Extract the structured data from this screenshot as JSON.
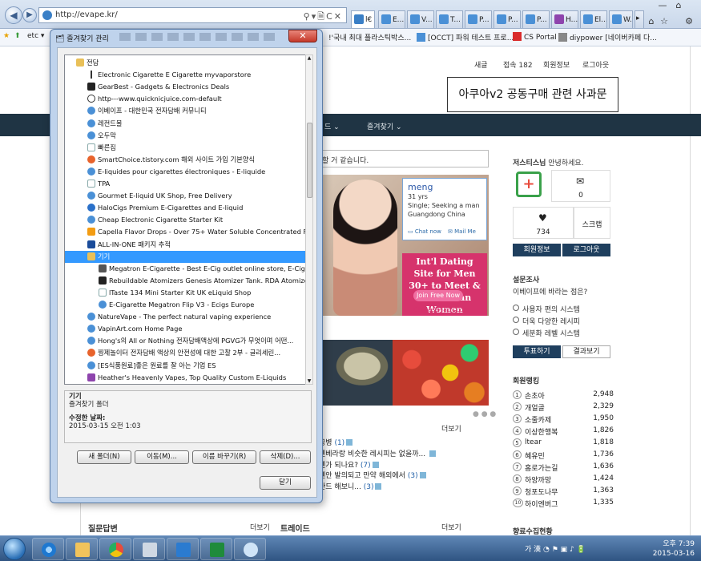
{
  "browser": {
    "url": "http://evape.kr/",
    "tabs": [
      "l€",
      "E...",
      "V...",
      "T...",
      "P...",
      "P...",
      "P...",
      "H...",
      "El...",
      "W..."
    ],
    "favorites_bar": [
      "etc",
      "!'국내 최대 플라스틱박스...",
      "[OCCT] 파워 테스트 프로...",
      "CS Portal",
      "diypower [네이버카페 다..."
    ]
  },
  "site": {
    "top_links": [
      "새글",
      "접속 182",
      "회원정보",
      "로그아웃"
    ],
    "notice": "아쿠아v2 공동구매 관련 사과문",
    "nav": [
      "드",
      "즐겨찾기"
    ],
    "marquee": "할 거 같습니다.",
    "ad": {
      "name": "meng",
      "age": "31 yrs",
      "seek": "Single; Seeking a man",
      "loc": "Guangdong China",
      "chat": "Chat now",
      "mail": "Mail Me",
      "headline": "Int'l Dating Site for Men 30+ to Meet & Date Asian Women",
      "join": "Join Free Now",
      "domain": "Chinese-lady.com"
    },
    "more1": "더보기",
    "posts": [
      {
        "text": "공병",
        "count": "(1)"
      },
      {
        "text": "덴베라랑 비슷한 레시피는 없을까...",
        "count": ""
      },
      {
        "text": "렌가 되나요?",
        "count": "(7)"
      },
      {
        "text": "텐안 발의되고 만약 해외에서",
        "count": "(3)"
      },
      {
        "text": "탄드 해보니...",
        "count": "(3)"
      }
    ],
    "bottom": {
      "qa": "질문답변",
      "trade": "트레이드",
      "more": "더보기",
      "more2": "더보기"
    },
    "sidebar": {
      "user": "저스티스님",
      "greet": "안녕하세요.",
      "mail_count": "0",
      "heart_count": "734",
      "scrap": "스크랩",
      "btn_info": "회원정보",
      "btn_logout": "로그아웃",
      "survey_title": "설문조사",
      "survey_q": "이베이프에 바라는 점은?",
      "survey_opts": [
        "사용자 편의 시스템",
        "더욱 다양한 레시피",
        "세분화 레벨 시스템"
      ],
      "vote": "투표하기",
      "result": "결과보기",
      "rank_title": "회원랭킹",
      "ranks": [
        {
          "n": "1",
          "name": "손초아",
          "pts": "2,948"
        },
        {
          "n": "2",
          "name": "개얼골",
          "pts": "2,329"
        },
        {
          "n": "3",
          "name": "소줄카제",
          "pts": "1,950"
        },
        {
          "n": "4",
          "name": "이상한행복",
          "pts": "1,826"
        },
        {
          "n": "5",
          "name": "ltear",
          "pts": "1,818"
        },
        {
          "n": "6",
          "name": "혜유민",
          "pts": "1,736"
        },
        {
          "n": "7",
          "name": "홈로가는길",
          "pts": "1,636"
        },
        {
          "n": "8",
          "name": "하양까망",
          "pts": "1,424"
        },
        {
          "n": "9",
          "name": "청포도나무",
          "pts": "1,363"
        },
        {
          "n": "10",
          "name": "하이엔버그",
          "pts": "1,335"
        }
      ],
      "stats_title": "향료수집현황"
    }
  },
  "dialog": {
    "title": "즐겨찾기 관리",
    "items": [
      {
        "label": "전담",
        "indent": 0,
        "type": "folder"
      },
      {
        "label": "Electronic Cigarette  E Cigarette  myvaporstore",
        "indent": 1,
        "type": "pen"
      },
      {
        "label": "GearBest - Gadgets & Electronics Deals",
        "indent": 1,
        "type": "gb"
      },
      {
        "label": "http---www.quicknicjuice.com-default",
        "indent": 1,
        "type": "drop"
      },
      {
        "label": "이베이프 - 대한민국 전자담배 커뮤니티",
        "indent": 1,
        "type": "ie"
      },
      {
        "label": "레전드몰",
        "indent": 1,
        "type": "ie"
      },
      {
        "label": "오두막",
        "indent": 1,
        "type": "ie"
      },
      {
        "label": "빠른집",
        "indent": 1,
        "type": "plain"
      },
      {
        "label": "SmartChoice.tistory.com  해외 사이트 가입 기본양식",
        "indent": 1,
        "type": "t"
      },
      {
        "label": "E-liquides pour cigarettes électroniques - E-liquide",
        "indent": 1,
        "type": "ie"
      },
      {
        "label": "TPA",
        "indent": 1,
        "type": "plain"
      },
      {
        "label": "Gourmet E-liquid UK Shop, Free Delivery",
        "indent": 1,
        "type": "ie"
      },
      {
        "label": "HaloCigs  Premium E-Cigarettes and E-liquid",
        "indent": 1,
        "type": "halo"
      },
      {
        "label": "Cheap Electronic Cigarette Starter Kit",
        "indent": 1,
        "type": "ie"
      },
      {
        "label": "Capella Flavor Drops - Over 75+ Water Soluble Concentrated Flav...",
        "indent": 1,
        "type": "cap"
      },
      {
        "label": "ALL-IN-ONE 패키지 추적",
        "indent": 1,
        "type": "17"
      },
      {
        "label": "기기",
        "indent": 1,
        "type": "folder",
        "selected": true
      },
      {
        "label": "Megatron E-Cigarette - Best E-Cig outlet online store, E-Cigare...",
        "indent": 2,
        "type": "cig"
      },
      {
        "label": "Rebuildable Atomizers Genesis Atomizer Tank. RDA Atomizer. ...",
        "indent": 2,
        "type": "gb"
      },
      {
        "label": "lTaste 134 Mini Starter Kit  UK eLiquid Shop",
        "indent": 2,
        "type": "plain"
      },
      {
        "label": "E-Cigarette Megatron Flip V3 - Ecigs Europe",
        "indent": 2,
        "type": "ie"
      },
      {
        "label": "NatureVape - The perfect natural vaping experience",
        "indent": 1,
        "type": "ie"
      },
      {
        "label": "VapinArt.com Home Page",
        "indent": 1,
        "type": "ie"
      },
      {
        "label": "Hong's의 All or Nothing  전자담배액상에 PGVG가 무엇이며 어떤...",
        "indent": 1,
        "type": "ie"
      },
      {
        "label": "찡제놀이터  전자담배 액상의 안전성에 대한 고찰 2부 - 글리세린...",
        "indent": 1,
        "type": "t"
      },
      {
        "label": "[ES식품원료]좋은 원료를 잘 아는 기업 ES",
        "indent": 1,
        "type": "ie"
      },
      {
        "label": "Heather's Heavenly Vapes, Top Quality Custom E-Liquids",
        "indent": 1,
        "type": "hh"
      }
    ],
    "info": {
      "name": "기기",
      "kind": "즐겨찾기 폴더",
      "modified_label": "수정한 날짜:",
      "modified": "2015-03-15 오전 1:03"
    },
    "buttons": [
      "새 폴더(N)",
      "이동(M)...",
      "이름 바꾸기(R)",
      "삭제(D)..."
    ],
    "close": "닫기"
  },
  "taskbar": {
    "time": "오후 7:39",
    "date": "2015-03-16",
    "tray": "가 漢"
  }
}
